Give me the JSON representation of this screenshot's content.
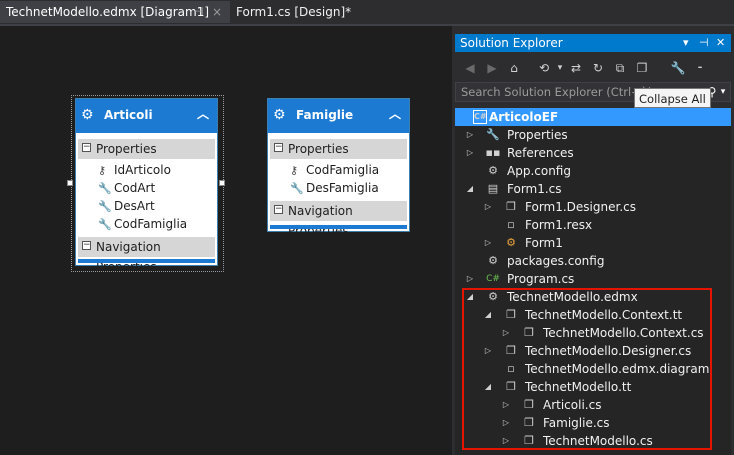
{
  "tabs": [
    {
      "label": "TechnetModello.edmx [Diagram1]",
      "active": true
    },
    {
      "label": "Form1.cs [Design]*",
      "active": false
    }
  ],
  "tab_icons": {
    "pin": "pin-icon",
    "close": "close-icon"
  },
  "entities": {
    "articoli": {
      "title": "Articoli",
      "properties_label": "Properties",
      "properties": [
        "IdArticolo",
        "CodArt",
        "DesArt",
        "CodFamiglia"
      ],
      "navigation_label": "Navigation Properties"
    },
    "famiglie": {
      "title": "Famiglie",
      "properties_label": "Properties",
      "properties": [
        "CodFamiglia",
        "DesFamiglia"
      ],
      "navigation_label": "Navigation Properties"
    }
  },
  "solution_explorer": {
    "title": "Solution Explorer",
    "search_placeholder": "Search Solution Explorer (Ctrl+è)",
    "tooltip": "Collapse All",
    "tree": [
      {
        "label": "ArticoloEF",
        "icon": "csharp-project-icon",
        "selected": true
      },
      {
        "label": "Properties",
        "icon": "wrench-icon",
        "arrow": "collapsed"
      },
      {
        "label": "References",
        "icon": "references-icon",
        "arrow": "collapsed"
      },
      {
        "label": "App.config",
        "icon": "config-icon"
      },
      {
        "label": "Form1.cs",
        "icon": "form-icon",
        "arrow": "expanded"
      },
      {
        "label": "Form1.Designer.cs",
        "icon": "cs-file-icon",
        "arrow": "collapsed"
      },
      {
        "label": "Form1.resx",
        "icon": "resx-icon"
      },
      {
        "label": "Form1",
        "icon": "class-icon",
        "arrow": "collapsed"
      },
      {
        "label": "packages.config",
        "icon": "config-icon"
      },
      {
        "label": "Program.cs",
        "icon": "csharp-file-icon",
        "arrow": "collapsed"
      },
      {
        "label": "TechnetModello.edmx",
        "icon": "edmx-icon",
        "arrow": "expanded"
      },
      {
        "label": "TechnetModello.Context.tt",
        "icon": "tt-file-icon",
        "arrow": "expanded"
      },
      {
        "label": "TechnetModello.Context.cs",
        "icon": "cs-file-icon",
        "arrow": "collapsed"
      },
      {
        "label": "TechnetModello.Designer.cs",
        "icon": "cs-file-icon",
        "arrow": "collapsed"
      },
      {
        "label": "TechnetModello.edmx.diagram",
        "icon": "file-icon"
      },
      {
        "label": "TechnetModello.tt",
        "icon": "tt-file-icon",
        "arrow": "expanded"
      },
      {
        "label": "Articoli.cs",
        "icon": "cs-file-icon",
        "arrow": "collapsed"
      },
      {
        "label": "Famiglie.cs",
        "icon": "cs-file-icon",
        "arrow": "collapsed"
      },
      {
        "label": "TechnetModello.cs",
        "icon": "cs-file-icon",
        "arrow": "collapsed"
      }
    ]
  },
  "colors": {
    "accent": "#007acc",
    "entity_header": "#1c7ad3",
    "highlight_border": "#e51400",
    "selected_row": "#3399ff"
  }
}
